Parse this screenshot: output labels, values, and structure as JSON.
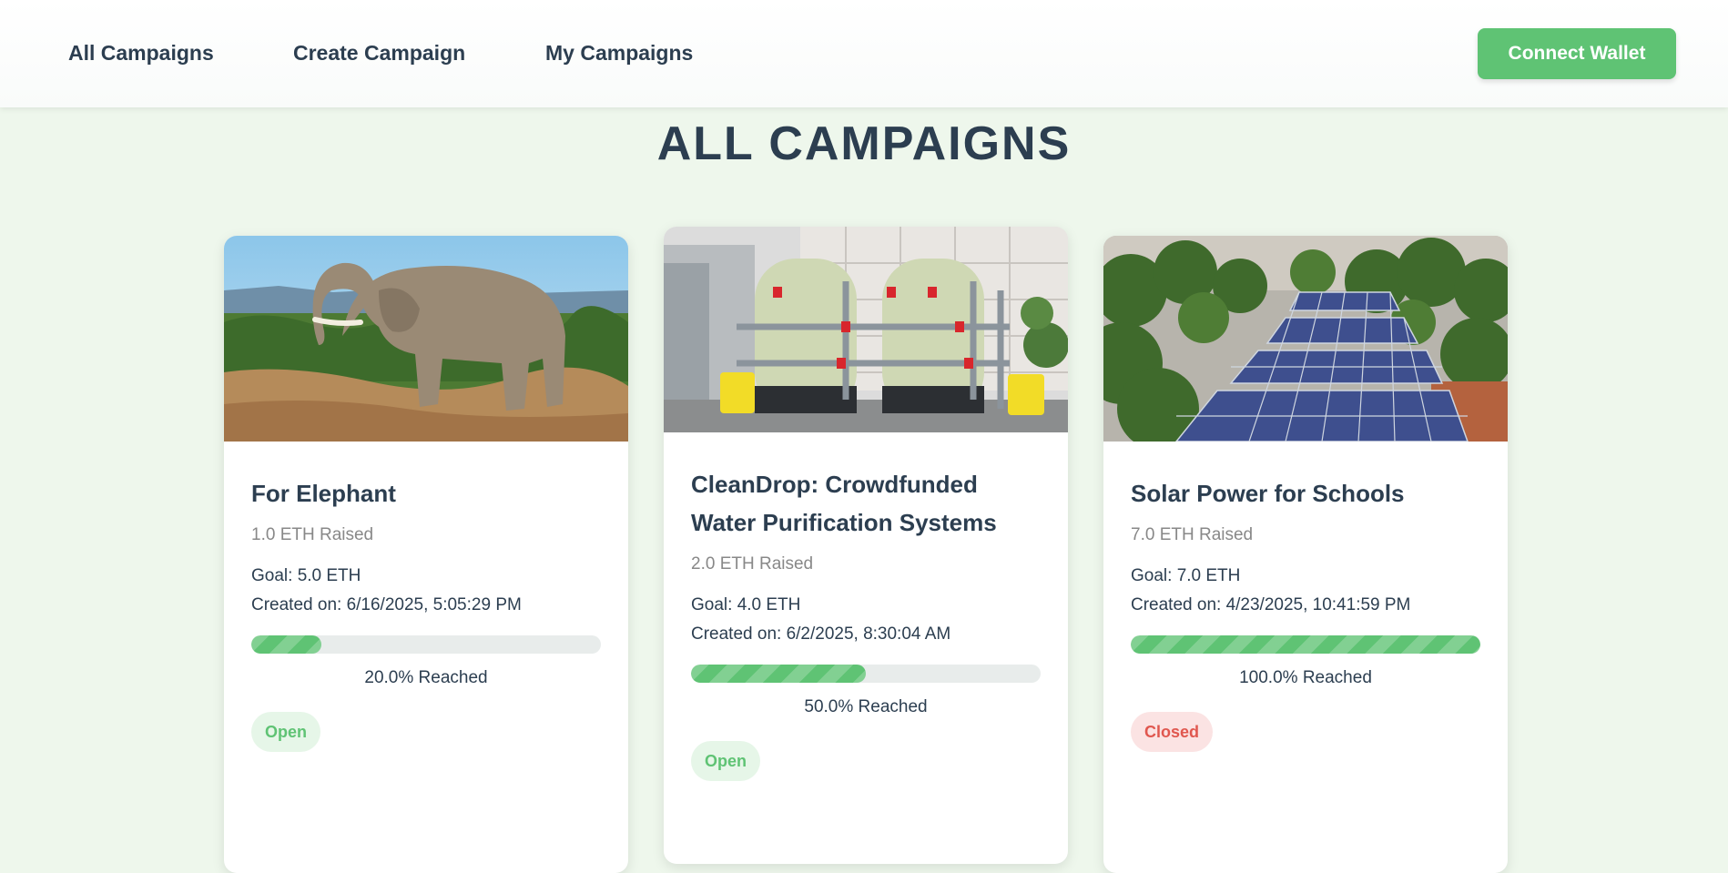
{
  "nav": {
    "links": [
      "All Campaigns",
      "Create Campaign",
      "My Campaigns"
    ],
    "connect_label": "Connect Wallet"
  },
  "page": {
    "title": "ALL CAMPAIGNS"
  },
  "campaigns": [
    {
      "title": "For Elephant",
      "raised": "1.0 ETH Raised",
      "goal": "Goal: 5.0 ETH",
      "created": "Created on: 6/16/2025, 5:05:29 PM",
      "progress": 0.2,
      "reached": "20.0% Reached",
      "status": "Open",
      "image": "elephant-photo"
    },
    {
      "title": "CleanDrop: Crowdfunded Water Purification Systems",
      "raised": "2.0 ETH Raised",
      "goal": "Goal: 4.0 ETH",
      "created": "Created on: 6/2/2025, 8:30:04 AM",
      "progress": 0.5,
      "reached": "50.0% Reached",
      "status": "Open",
      "image": "water-purification-tanks-photo"
    },
    {
      "title": "Solar Power for Schools",
      "raised": "7.0 ETH Raised",
      "goal": "Goal: 7.0 ETH",
      "created": "Created on: 4/23/2025, 10:41:59 PM",
      "progress": 1.0,
      "reached": "100.0% Reached",
      "status": "Closed",
      "image": "solar-panels-photo"
    }
  ],
  "colors": {
    "accent": "#5fc374",
    "background": "#eef7ec",
    "text": "#2c3e50",
    "closed": "#e0574f"
  }
}
